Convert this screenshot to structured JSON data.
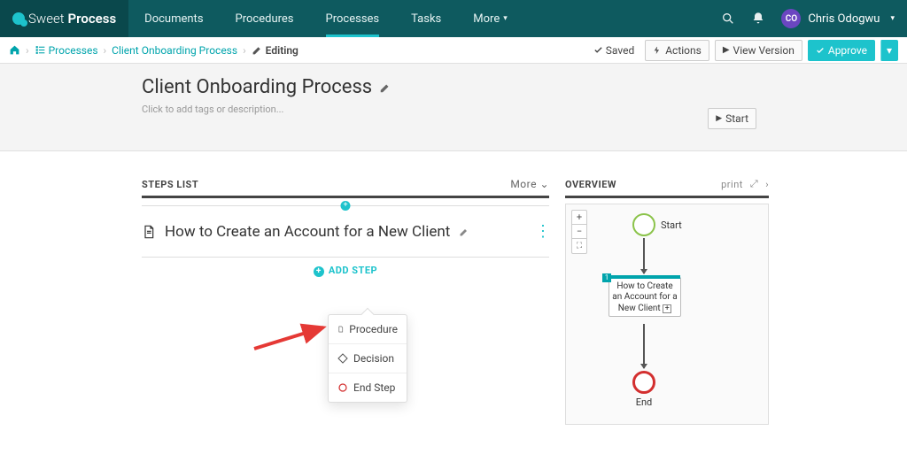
{
  "brand": {
    "thin": "Sweet",
    "bold": "Process"
  },
  "nav": {
    "items": [
      "Documents",
      "Procedures",
      "Processes",
      "Tasks"
    ],
    "more": "More",
    "user_initials": "CO",
    "user_name": "Chris Odogwu"
  },
  "breadcrumb": {
    "processes": "Processes",
    "current": "Client Onboarding Process",
    "mode": "Editing"
  },
  "toolbar": {
    "saved": "Saved",
    "actions": "Actions",
    "view_version": "View Version",
    "approve": "Approve"
  },
  "header": {
    "title": "Client Onboarding Process",
    "tags_hint": "Click to add tags or description...",
    "start": "Start"
  },
  "steps": {
    "heading": "STEPS LIST",
    "more": "More",
    "step1": "How to Create an Account for a New Client",
    "add_step": "ADD STEP"
  },
  "popover": {
    "procedure": "Procedure",
    "decision": "Decision",
    "end_step": "End Step"
  },
  "overview": {
    "heading": "OVERVIEW",
    "print": "print",
    "start": "Start",
    "node1": "How to Create an Account for a New Client",
    "end": "End"
  }
}
